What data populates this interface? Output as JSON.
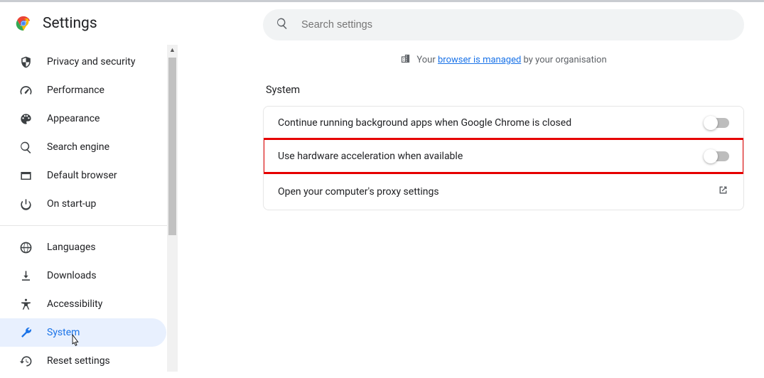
{
  "header": {
    "title": "Settings"
  },
  "search": {
    "placeholder": "Search settings"
  },
  "sidebar": {
    "group1": [
      {
        "label": "Privacy and security"
      },
      {
        "label": "Performance"
      },
      {
        "label": "Appearance"
      },
      {
        "label": "Search engine"
      },
      {
        "label": "Default browser"
      },
      {
        "label": "On start-up"
      }
    ],
    "group2": [
      {
        "label": "Languages"
      },
      {
        "label": "Downloads"
      },
      {
        "label": "Accessibility"
      },
      {
        "label": "System"
      },
      {
        "label": "Reset settings"
      }
    ]
  },
  "managed": {
    "prefix": "Your ",
    "link": "browser is managed",
    "suffix": " by your organisation"
  },
  "section": {
    "title": "System"
  },
  "rows": {
    "bg": "Continue running background apps when Google Chrome is closed",
    "hw": "Use hardware acceleration when available",
    "proxy": "Open your computer's proxy settings"
  }
}
